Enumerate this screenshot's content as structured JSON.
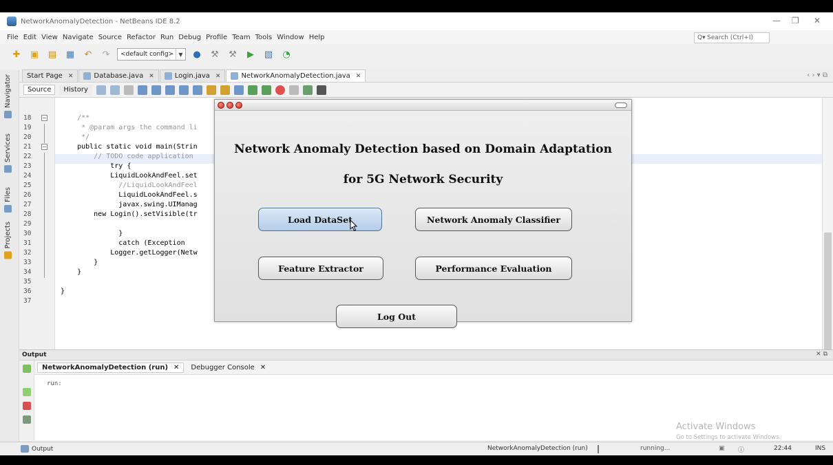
{
  "window": {
    "title": "NetworkAnomalyDetection - NetBeans IDE 8.2",
    "controls": [
      "—",
      "❐",
      "✕"
    ]
  },
  "menu": [
    "File",
    "Edit",
    "View",
    "Navigate",
    "Source",
    "Refactor",
    "Run",
    "Debug",
    "Profile",
    "Team",
    "Tools",
    "Window",
    "Help"
  ],
  "search": {
    "placeholder": "Search (Ctrl+I)"
  },
  "toolbar": {
    "config": "<default config>"
  },
  "sidebar": [
    "Navigator",
    "Services",
    "Files",
    "Projects"
  ],
  "editor_tabs": [
    {
      "label": "Start Page",
      "close": "✕"
    },
    {
      "label": "Database.java",
      "close": "✕"
    },
    {
      "label": "Login.java",
      "close": "✕"
    },
    {
      "label": "NetworkAnomalyDetection.java",
      "close": "✕"
    }
  ],
  "source_tabs": {
    "source": "Source",
    "history": "History"
  },
  "code": {
    "lines": [
      {
        "n": "18",
        "text": "    /**"
      },
      {
        "n": "19",
        "text": "     * @param args the command li"
      },
      {
        "n": "20",
        "text": "     */"
      },
      {
        "n": "21",
        "text": "    public static void main(Strin"
      },
      {
        "n": "22",
        "text": "        // TODO code application"
      },
      {
        "n": "23",
        "text": "            try {"
      },
      {
        "n": "24",
        "text": "            LiquidLookAndFeel.set"
      },
      {
        "n": "25",
        "text": "              //LiquidLookAndFeel"
      },
      {
        "n": "26",
        "text": "              LiquidLookAndFeel.s"
      },
      {
        "n": "27",
        "text": "              javax.swing.UIManag"
      },
      {
        "n": "28",
        "text": "        new Login().setVisible(tr"
      },
      {
        "n": "29",
        "text": ""
      },
      {
        "n": "30",
        "text": "              }"
      },
      {
        "n": "31",
        "text": "              catch (Exception"
      },
      {
        "n": "32",
        "text": "            Logger.getLogger(Netw"
      },
      {
        "n": "33",
        "text": "        }"
      },
      {
        "n": "34",
        "text": "    }"
      },
      {
        "n": "35",
        "text": ""
      },
      {
        "n": "36",
        "text": "}"
      },
      {
        "n": "37",
        "text": ""
      }
    ]
  },
  "dialog": {
    "title_line1": "Network Anomaly Detection based on Domain Adaptation",
    "title_line2": "for 5G Network Security",
    "buttons": {
      "load_dataset": "Load DataSet",
      "classifier": "Network Anomaly Classifier",
      "feature_extractor": "Feature Extractor",
      "performance": "Performance Evaluation",
      "logout": "Log Out"
    }
  },
  "output": {
    "header": "Output",
    "tabs": [
      {
        "label": "NetworkAnomalyDetection (run)",
        "close": "✕"
      },
      {
        "label": "Debugger Console",
        "close": "✕"
      }
    ],
    "text": "run:",
    "header_controls": "✕ ⧉"
  },
  "watermark": {
    "line1": "Activate Windows",
    "line2": "Go to Settings to activate Windows."
  },
  "status": {
    "left": "Output",
    "task": "NetworkAnomalyDetection (run)",
    "state": "running...",
    "time": "22:44",
    "mode": "INS"
  }
}
